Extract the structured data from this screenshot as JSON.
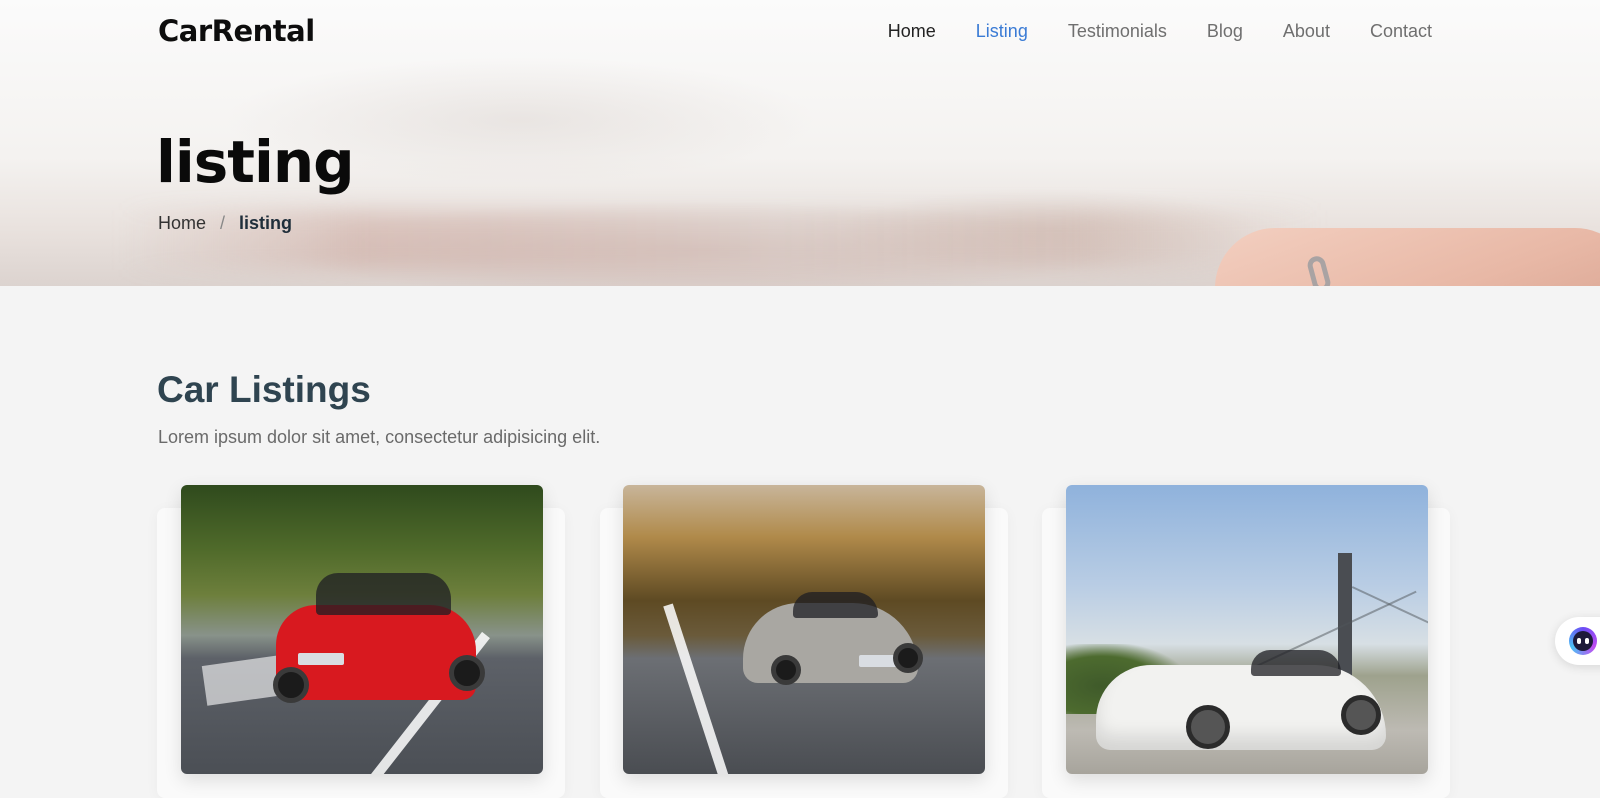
{
  "brand": {
    "logo_text": "CarRental"
  },
  "nav": {
    "items": [
      {
        "label": "Home"
      },
      {
        "label": "Listing"
      },
      {
        "label": "Testimonials"
      },
      {
        "label": "Blog"
      },
      {
        "label": "About"
      },
      {
        "label": "Contact"
      }
    ],
    "active_index": 1
  },
  "hero": {
    "title": "listing",
    "breadcrumb": {
      "home": "Home",
      "separator": "/",
      "current": "listing"
    }
  },
  "section": {
    "title": "Car Listings",
    "subtitle": "Lorem ipsum dolor sit amet, consectetur adipisicing elit."
  },
  "listings": [
    {
      "image_subject": "red hatchback on forest road"
    },
    {
      "image_subject": "silver sports coupe on autumn road"
    },
    {
      "image_subject": "white grand tourer by suspension bridge"
    }
  ],
  "colors": {
    "accent": "#3a7bd5",
    "heading": "#2f4450",
    "background": "#f4f4f4"
  },
  "icons": {
    "chat_widget": "chat-bot-icon"
  }
}
